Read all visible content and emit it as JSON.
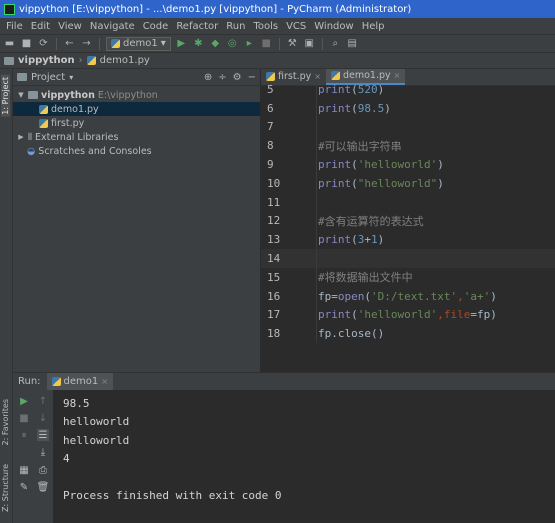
{
  "window": {
    "title": "vippython [E:\\vippython] - ...\\demo1.py [vippython] - PyCharm (Administrator)"
  },
  "menu": [
    "File",
    "Edit",
    "View",
    "Navigate",
    "Code",
    "Refactor",
    "Run",
    "Tools",
    "VCS",
    "Window",
    "Help"
  ],
  "toolbar": {
    "run_config": "demo1"
  },
  "breadcrumb": {
    "project": "vippython",
    "file": "demo1.py"
  },
  "sidebar": {
    "project_tab": "1: Project",
    "favorites_tab": "2: Favorites",
    "structure_tab": "Z: Structure"
  },
  "project_panel": {
    "title": "Project",
    "root": {
      "name": "vippython",
      "path": "E:\\vippython"
    },
    "files": [
      "demo1.py",
      "first.py"
    ],
    "external": "External Libraries",
    "scratches": "Scratches and Consoles"
  },
  "editor": {
    "tabs": [
      {
        "label": "first.py"
      },
      {
        "label": "demo1.py"
      }
    ],
    "lines": [
      {
        "num": "5",
        "segments": [
          {
            "t": "print",
            "c": "print"
          },
          {
            "t": "(",
            "c": "default"
          },
          {
            "t": "520",
            "c": "num"
          },
          {
            "t": ")",
            "c": "default"
          }
        ]
      },
      {
        "num": "6",
        "segments": [
          {
            "t": "print",
            "c": "print"
          },
          {
            "t": "(",
            "c": "default"
          },
          {
            "t": "98.5",
            "c": "num"
          },
          {
            "t": ")",
            "c": "default"
          }
        ]
      },
      {
        "num": "7",
        "segments": []
      },
      {
        "num": "8",
        "segments": [
          {
            "t": "#可以输出字符串",
            "c": "comment"
          }
        ]
      },
      {
        "num": "9",
        "segments": [
          {
            "t": "print",
            "c": "print"
          },
          {
            "t": "(",
            "c": "default"
          },
          {
            "t": "'helloworld'",
            "c": "str"
          },
          {
            "t": ")",
            "c": "default"
          }
        ]
      },
      {
        "num": "10",
        "segments": [
          {
            "t": "print",
            "c": "print"
          },
          {
            "t": "(",
            "c": "default"
          },
          {
            "t": "\"helloworld\"",
            "c": "str"
          },
          {
            "t": ")",
            "c": "default"
          }
        ]
      },
      {
        "num": "11",
        "segments": []
      },
      {
        "num": "12",
        "segments": [
          {
            "t": "#含有运算符的表达式",
            "c": "comment"
          }
        ]
      },
      {
        "num": "13",
        "segments": [
          {
            "t": "print",
            "c": "print"
          },
          {
            "t": "(",
            "c": "default"
          },
          {
            "t": "3",
            "c": "num"
          },
          {
            "t": "+",
            "c": "default"
          },
          {
            "t": "1",
            "c": "num"
          },
          {
            "t": ")",
            "c": "default"
          }
        ]
      },
      {
        "num": "14",
        "segments": [],
        "current": true
      },
      {
        "num": "15",
        "segments": [
          {
            "t": "#将数据输出文件中",
            "c": "comment"
          }
        ]
      },
      {
        "num": "16",
        "segments": [
          {
            "t": "fp",
            "c": "default"
          },
          {
            "t": "=",
            "c": "default"
          },
          {
            "t": "open",
            "c": "print"
          },
          {
            "t": "(",
            "c": "default"
          },
          {
            "t": "'D:/text.txt'",
            "c": "str"
          },
          {
            "t": ",",
            "c": "kw"
          },
          {
            "t": "'a+'",
            "c": "str"
          },
          {
            "t": ")",
            "c": "default"
          }
        ]
      },
      {
        "num": "17",
        "segments": [
          {
            "t": "print",
            "c": "print"
          },
          {
            "t": "(",
            "c": "default"
          },
          {
            "t": "'helloworld'",
            "c": "str"
          },
          {
            "t": ",",
            "c": "kw"
          },
          {
            "t": "file",
            "c": "kw"
          },
          {
            "t": "=",
            "c": "default"
          },
          {
            "t": "fp",
            "c": "default"
          },
          {
            "t": ")",
            "c": "default"
          }
        ]
      },
      {
        "num": "18",
        "segments": [
          {
            "t": "fp",
            "c": "default"
          },
          {
            "t": ".",
            "c": "default"
          },
          {
            "t": "close",
            "c": "default"
          },
          {
            "t": "()",
            "c": "default"
          }
        ]
      }
    ]
  },
  "run_panel": {
    "label": "Run:",
    "tab": "demo1",
    "output": [
      "98.5",
      "helloworld",
      "helloworld",
      "4",
      "",
      "Process finished with exit code 0"
    ]
  }
}
